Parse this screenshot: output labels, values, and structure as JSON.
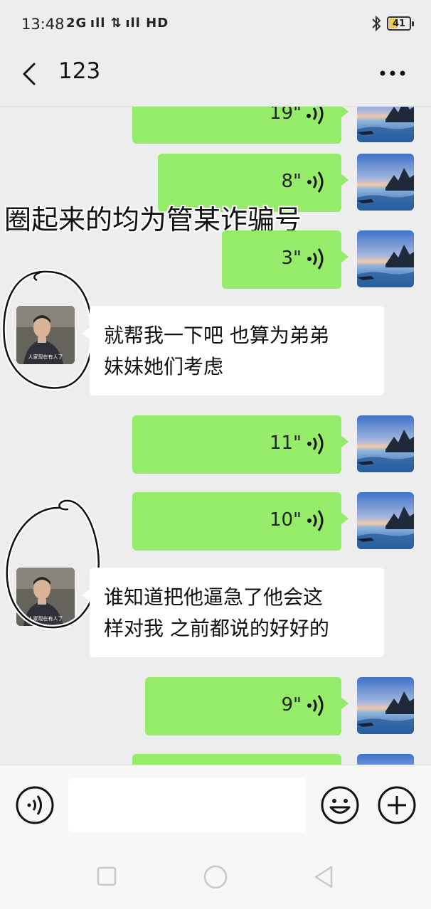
{
  "status_bar": {
    "time": "13:48",
    "signal_text": "2G ıll ⇅ ıll HD",
    "battery_level": "41"
  },
  "header": {
    "title": "123"
  },
  "overlay_caption": "圈起来的均为管某诈骗号",
  "messages": [
    {
      "side": "right",
      "type": "voice",
      "duration": "19\""
    },
    {
      "side": "right",
      "type": "voice",
      "duration": "8\""
    },
    {
      "side": "right",
      "type": "voice",
      "duration": "3\""
    },
    {
      "side": "left",
      "type": "text",
      "lines": [
        "就帮我一下吧 也算为弟弟",
        "妹妹她们考虑"
      ]
    },
    {
      "side": "right",
      "type": "voice",
      "duration": "11\""
    },
    {
      "side": "right",
      "type": "voice",
      "duration": "10\""
    },
    {
      "side": "left",
      "type": "text",
      "lines": [
        "谁知道把他逼急了他会这",
        "样对我 之前都说的好好的"
      ]
    },
    {
      "side": "right",
      "type": "voice",
      "duration": "9\""
    },
    {
      "side": "right",
      "type": "voice",
      "duration": ""
    }
  ],
  "avatar_caption": "人家现在有人了",
  "input": {
    "value": "",
    "placeholder": ""
  },
  "icons": {
    "back": "chevron-left-icon",
    "more": "more-dots-icon",
    "voice_wave": "voice-wave-icon",
    "voice_input": "voice-input-icon",
    "emoji": "emoji-icon",
    "plus": "plus-icon",
    "bluetooth": "bluetooth-icon"
  },
  "colors": {
    "bubble_self": "#95ec69",
    "bubble_other": "#ffffff",
    "background": "#ededed",
    "battery_fill": "#f2c94c"
  }
}
